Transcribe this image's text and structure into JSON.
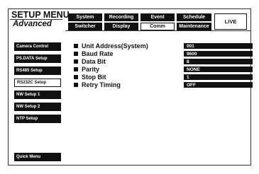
{
  "header": {
    "title": "SETUP MENU",
    "subtitle": "Advanced",
    "live_label": "LIVE"
  },
  "tabs": [
    {
      "label": "System",
      "active": false
    },
    {
      "label": "Recording",
      "active": false
    },
    {
      "label": "Event",
      "active": false
    },
    {
      "label": "Schedule",
      "active": false
    },
    {
      "label": "Switcher",
      "active": false
    },
    {
      "label": "Display",
      "active": false
    },
    {
      "label": "Comm",
      "active": true
    },
    {
      "label": "Maintenance",
      "active": false
    }
  ],
  "sidebar": {
    "items": [
      {
        "label": "Camera Control",
        "active": false
      },
      {
        "label": "PS.DATA Setup",
        "active": false
      },
      {
        "label": "RS485 Setup",
        "active": false
      },
      {
        "label": "RS232C Setup",
        "active": true
      },
      {
        "label": "NW Setup 1",
        "active": false
      },
      {
        "label": "NW Setup 2",
        "active": false
      },
      {
        "label": "NTP Setup",
        "active": false
      }
    ],
    "quick_menu": "Quick Menu"
  },
  "settings": [
    {
      "label": "Unit Address(System)",
      "value": "001"
    },
    {
      "label": "Baud Rate",
      "value": "9600"
    },
    {
      "label": "Data Bit",
      "value": "8"
    },
    {
      "label": "Parity",
      "value": "NONE"
    },
    {
      "label": "Stop Bit",
      "value": "1"
    },
    {
      "label": "Retry Timing",
      "value": "OFF"
    }
  ],
  "colors": {
    "dark": "#111111",
    "light": "#ffffff"
  }
}
